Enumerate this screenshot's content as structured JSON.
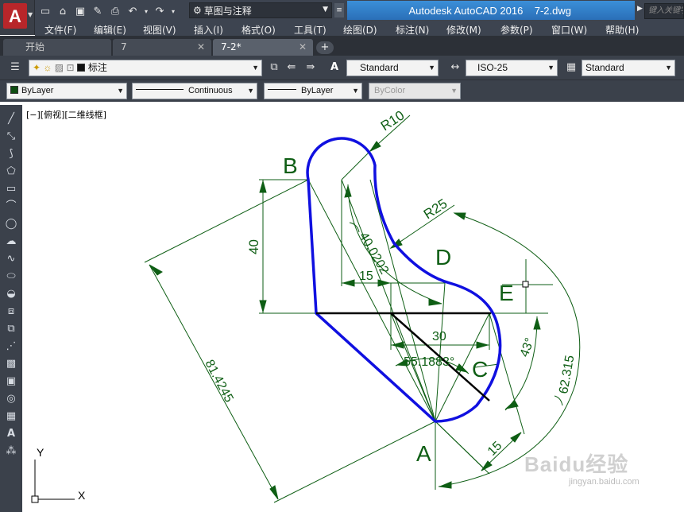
{
  "title_bar": {
    "app_title": "Autodesk AutoCAD 2016    7-2.dwg",
    "workspace": "草图与注释",
    "search_placeholder": "键入关键字"
  },
  "menu": [
    "文件(F)",
    "编辑(E)",
    "视图(V)",
    "插入(I)",
    "格式(O)",
    "工具(T)",
    "绘图(D)",
    "标注(N)",
    "修改(M)",
    "参数(P)",
    "窗口(W)",
    "帮助(H)"
  ],
  "tabs": [
    {
      "label": "开始",
      "closable": false
    },
    {
      "label": "7",
      "closable": true
    },
    {
      "label": "7-2*",
      "closable": true,
      "active": true
    }
  ],
  "toolbar": {
    "layer": "标注",
    "text_style": "Standard",
    "dim_style": "ISO-25",
    "table_style": "Standard",
    "color": "ByLayer",
    "linetype": "Continuous",
    "lineweight": "ByLayer",
    "plot_style": "ByColor"
  },
  "viewport_label": "[−][俯视][二维线框]",
  "drawing": {
    "dimensions": {
      "r10": "R10",
      "r25": "R25",
      "d40": "40",
      "d15_top": "15",
      "d40_0202": "40.0202",
      "d30": "30",
      "angle_55_1883": "55.1883°",
      "angle_43": "43°",
      "d62_315": "62.315",
      "d81_4245": "81.4245",
      "d15_bottom": "15"
    },
    "points": {
      "a": "A",
      "b": "B",
      "c": "C",
      "d": "D",
      "e": "E"
    },
    "ucs": {
      "x": "X",
      "y": "Y"
    },
    "colors": {
      "dimension": "#0e5e14",
      "profile": "#1010e0",
      "line": "#000000"
    }
  },
  "watermark": {
    "logo": "Baidu经验",
    "url": "jingyan.baidu.com"
  }
}
